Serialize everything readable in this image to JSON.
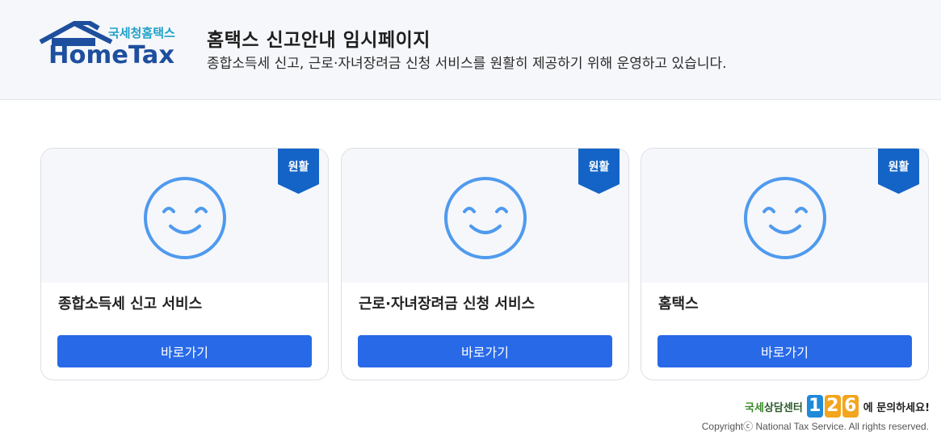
{
  "header": {
    "logo": {
      "org": "국세청홈택스",
      "wordmark": "HomeTax"
    },
    "title": "홈택스 신고안내 임시페이지",
    "subtitle": "종합소득세 신고, 근로·자녀장려금 신청 서비스를 원활히 제공하기 위해 운영하고 있습니다."
  },
  "cards": [
    {
      "status": "원활",
      "title": "종합소득세 신고 서비스",
      "button": "바로가기",
      "icon": "smile-icon"
    },
    {
      "status": "원활",
      "title": "근로·자녀장려금 신청 서비스",
      "button": "바로가기",
      "icon": "smile-icon"
    },
    {
      "status": "원활",
      "title": "홈택스",
      "button": "바로가기",
      "icon": "smile-icon"
    }
  ],
  "footer": {
    "helpline": {
      "brand_prefix": "국세",
      "brand_suffix": "상담센터",
      "digits": [
        "1",
        "2",
        "6"
      ],
      "suffix": "에 문의하세요!"
    },
    "copyright": "Copyrightⓒ National Tax Service. All rights reserved."
  },
  "colors": {
    "primary_button": "#2869e8",
    "ribbon": "#1464c8",
    "smile": "#4f9aee",
    "header_bg": "#f6f7fb",
    "digit_1": "#1f8ad8",
    "digit_2": "#f2a51d",
    "digit_6": "#f2a51d"
  }
}
